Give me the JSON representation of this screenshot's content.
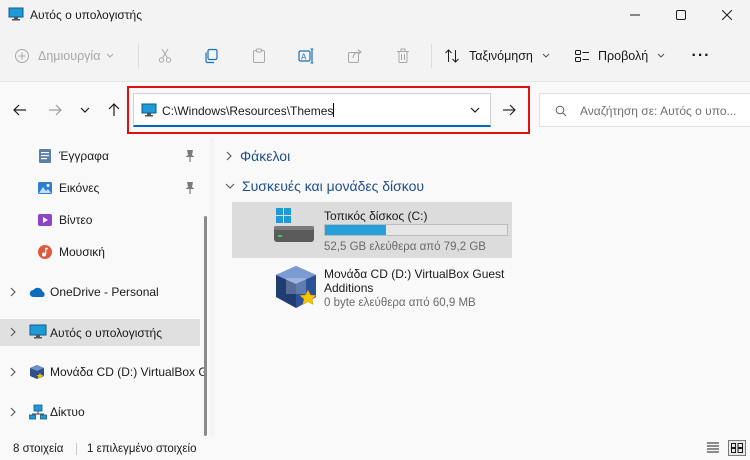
{
  "window": {
    "title": "Αυτός ο υπολογιστής"
  },
  "toolbar": {
    "new_label": "Δημιουργία",
    "sort_label": "Ταξινόμηση",
    "view_label": "Προβολή",
    "more_label": "···"
  },
  "address": {
    "path": "C:\\Windows\\Resources\\Themes"
  },
  "search": {
    "placeholder": "Αναζήτηση σε: Αυτός ο υπο..."
  },
  "sidebar": {
    "items": [
      {
        "label": "Έγγραφα",
        "icon": "documents-icon",
        "pinned": true
      },
      {
        "label": "Εικόνες",
        "icon": "pictures-icon",
        "pinned": true
      },
      {
        "label": "Βίντεο",
        "icon": "videos-icon",
        "pinned": false
      },
      {
        "label": "Μουσική",
        "icon": "music-icon",
        "pinned": false
      },
      {
        "label": "OneDrive - Personal",
        "icon": "onedrive-icon",
        "expandable": true
      },
      {
        "label": "Αυτός ο υπολογιστής",
        "icon": "this-pc-icon",
        "expandable": true,
        "selected": true
      },
      {
        "label": "Μονάδα CD (D:) VirtualBox G",
        "icon": "cd-drive-icon",
        "expandable": true
      },
      {
        "label": "Δίκτυο",
        "icon": "network-icon",
        "expandable": true
      }
    ]
  },
  "main": {
    "groups": {
      "folders": "Φάκελοι",
      "devices": "Συσκευές και μονάδες δίσκου"
    },
    "drives": [
      {
        "name": "Τοπικός δίσκος (C:)",
        "free_text": "52,5 GB ελεύθερα από 79,2 GB",
        "used_fraction": 0.337,
        "icon": "hard-drive-icon"
      },
      {
        "name_line1": "Μονάδα CD (D:) VirtualBox Guest",
        "name_line2": "Additions",
        "free_text": "0 byte ελεύθερα από 60,9 MB",
        "icon": "virtualbox-cd-icon"
      }
    ]
  },
  "status": {
    "count": "8 στοιχεία",
    "selected": "1 επιλεγμένο στοιχείο"
  },
  "colors": {
    "accent": "#0067c0",
    "highlight_box": "#e01010",
    "progress": "#26a0da",
    "group_header": "#1f4e8c"
  }
}
